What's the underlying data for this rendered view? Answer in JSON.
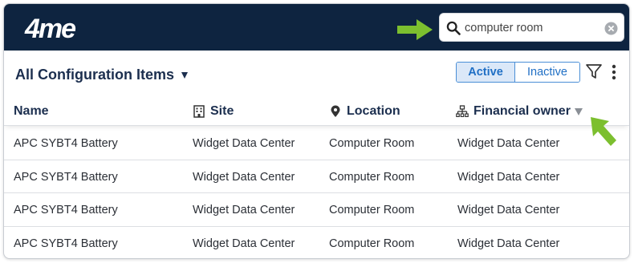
{
  "brand": {
    "logo_text": "4me",
    "header_color": "#0e2440",
    "accent": "#1f6fc5",
    "arrow_color": "#7cbf2f"
  },
  "search": {
    "value": "computer room",
    "icon": "search-icon",
    "clear_icon": "clear-icon"
  },
  "toolbar": {
    "view_title": "All Configuration Items",
    "toggle": {
      "active_label": "Active",
      "inactive_label": "Inactive",
      "selected": "Active"
    },
    "filter_icon": "filter-icon",
    "more_icon": "more-vertical-icon"
  },
  "table": {
    "columns": [
      {
        "label": "Name",
        "icon": ""
      },
      {
        "label": "Site",
        "icon": "building-icon"
      },
      {
        "label": "Location",
        "icon": "map-pin-icon"
      },
      {
        "label": "Financial owner",
        "icon": "org-chart-icon",
        "sorted": "descending"
      }
    ],
    "rows": [
      [
        "APC SYBT4 Battery",
        "Widget Data Center",
        "Computer Room",
        "Widget Data Center"
      ],
      [
        "APC SYBT4 Battery",
        "Widget Data Center",
        "Computer Room",
        "Widget Data Center"
      ],
      [
        "APC SYBT4 Battery",
        "Widget Data Center",
        "Computer Room",
        "Widget Data Center"
      ],
      [
        "APC SYBT4 Battery",
        "Widget Data Center",
        "Computer Room",
        "Widget Data Center"
      ]
    ]
  }
}
